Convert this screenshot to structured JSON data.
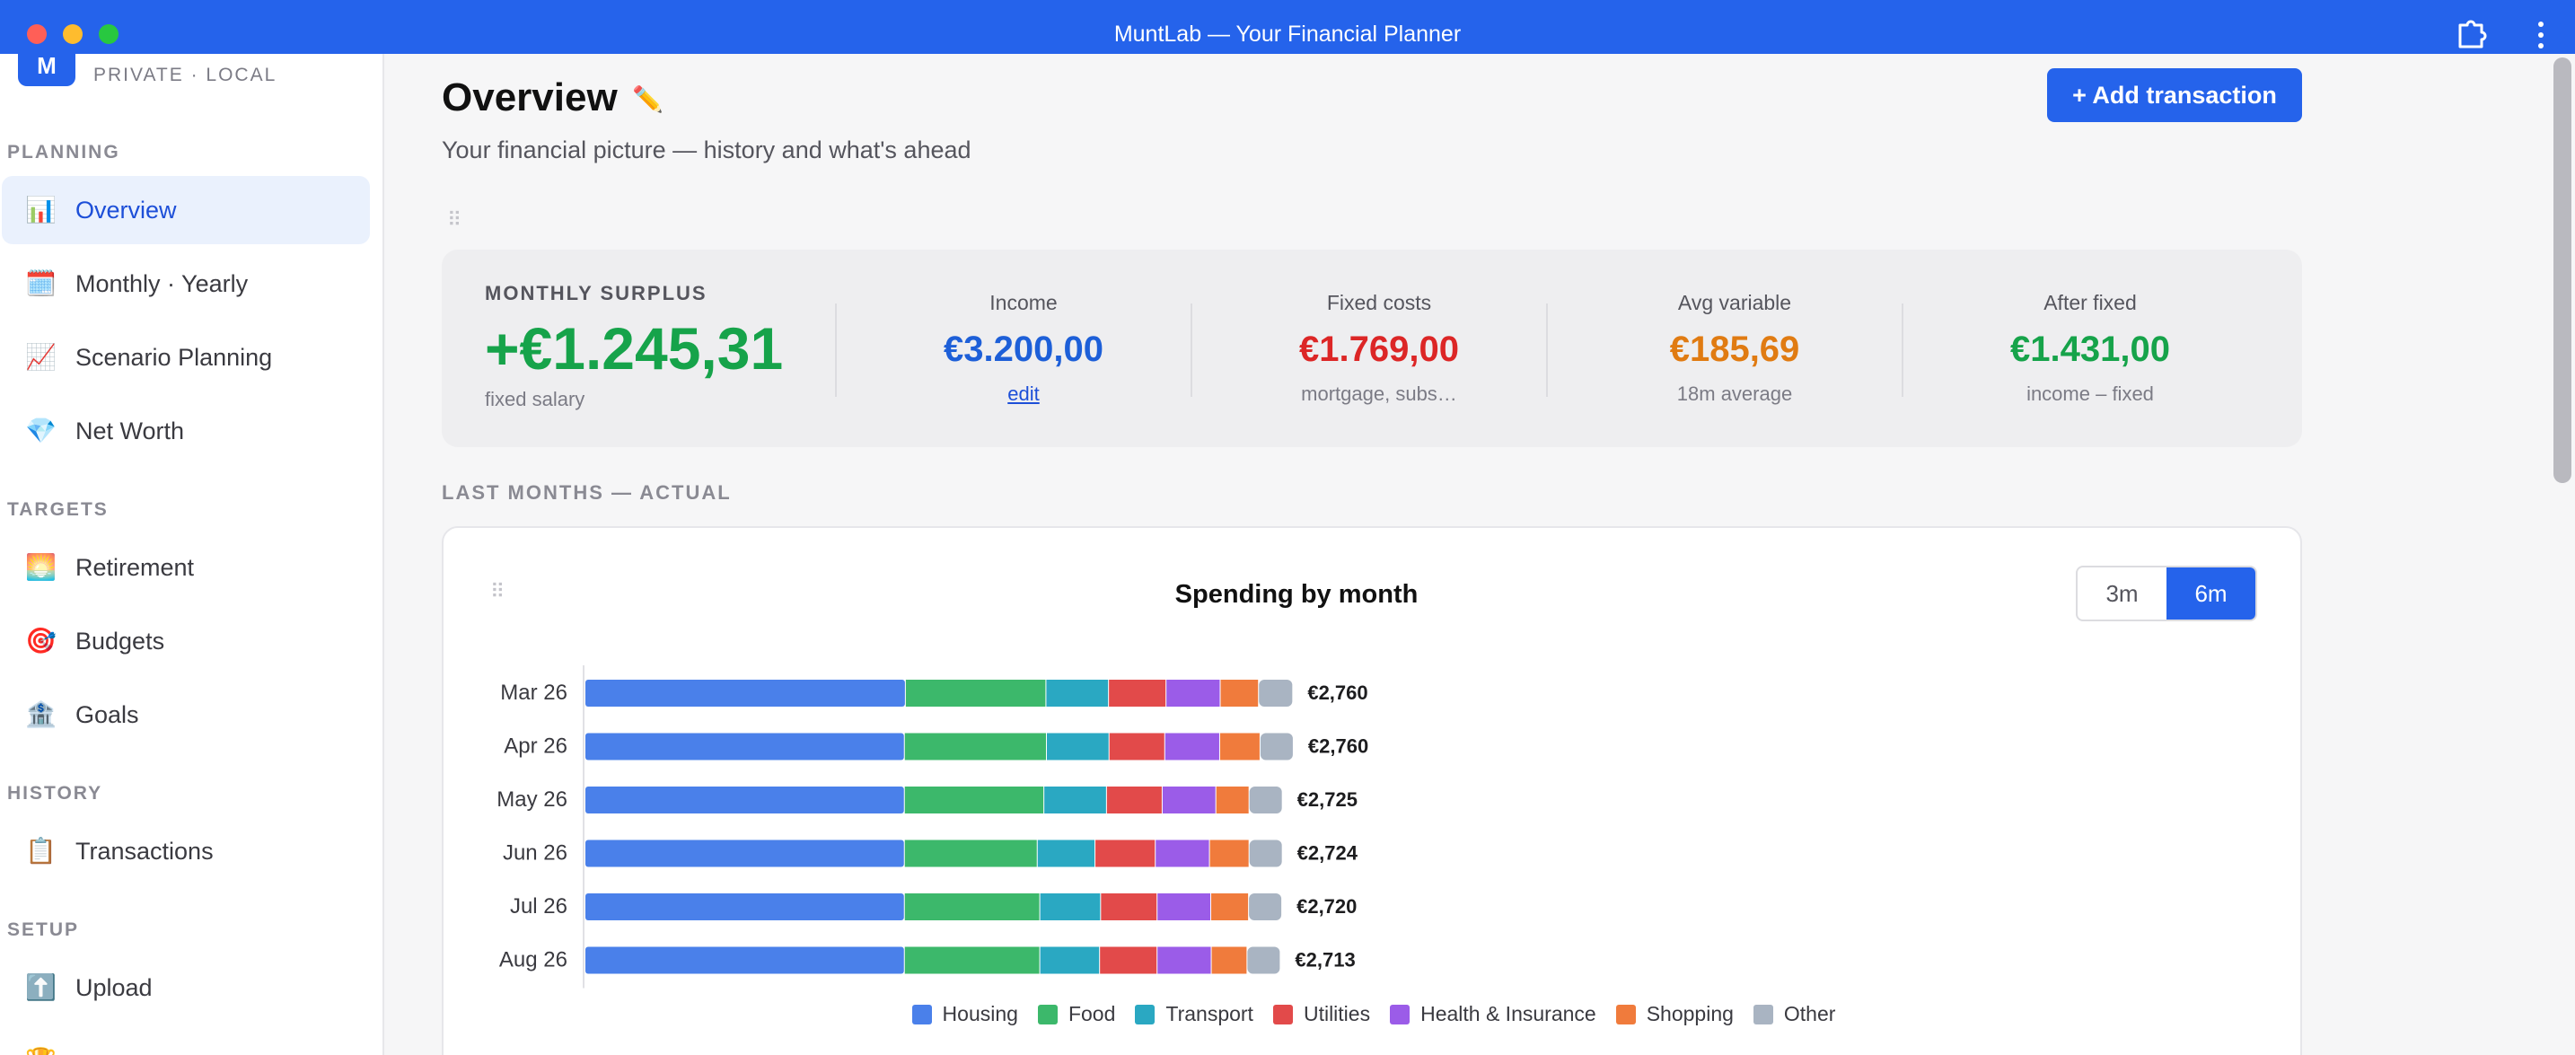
{
  "window": {
    "title": "MuntLab — Your Financial Planner"
  },
  "brand": {
    "logo_letter": "M",
    "subtitle": "PRIVATE · LOCAL"
  },
  "sidebar": {
    "sections": [
      {
        "label": "PLANNING",
        "items": [
          {
            "label": "Overview",
            "icon": "bar-chart-icon",
            "glyph": "📊",
            "active": true
          },
          {
            "label": "Monthly · Yearly",
            "icon": "calendar-icon",
            "glyph": "🗓️"
          },
          {
            "label": "Scenario Planning",
            "icon": "trend-chart-icon",
            "glyph": "📈"
          },
          {
            "label": "Net Worth",
            "icon": "gem-icon",
            "glyph": "💎"
          }
        ]
      },
      {
        "label": "TARGETS",
        "items": [
          {
            "label": "Retirement",
            "icon": "sunrise-icon",
            "glyph": "🌅"
          },
          {
            "label": "Budgets",
            "icon": "target-icon",
            "glyph": "🎯"
          },
          {
            "label": "Goals",
            "icon": "bank-icon",
            "glyph": "🏦"
          }
        ]
      },
      {
        "label": "HISTORY",
        "items": [
          {
            "label": "Transactions",
            "icon": "clipboard-icon",
            "glyph": "📋"
          }
        ]
      },
      {
        "label": "SETUP",
        "items": [
          {
            "label": "Upload",
            "icon": "upload-icon",
            "glyph": "⬆️"
          }
        ]
      }
    ]
  },
  "header": {
    "title": "Overview",
    "subtitle": "Your financial picture — history and what's ahead",
    "add_button": "+ Add transaction"
  },
  "summary": {
    "main": {
      "label": "MONTHLY SURPLUS",
      "value": "+€1.245,31",
      "note": "fixed salary"
    },
    "columns": [
      {
        "label": "Income",
        "value": "€3.200,00",
        "note": "edit",
        "color": "#1d5fd8",
        "link": true
      },
      {
        "label": "Fixed costs",
        "value": "€1.769,00",
        "note": "mortgage, subs…",
        "color": "#dc2626"
      },
      {
        "label": "Avg variable",
        "value": "€185,69",
        "note": "18m average",
        "color": "#e07b12"
      },
      {
        "label": "After fixed",
        "value": "€1.431,00",
        "note": "income – fixed",
        "color": "#16a34a"
      }
    ]
  },
  "section_title": "LAST MONTHS — ACTUAL",
  "chart_card": {
    "range_options": [
      "3m",
      "6m"
    ],
    "selected_range": "6m"
  },
  "chart_data": {
    "type": "bar",
    "orientation": "horizontal",
    "stacked": true,
    "title": "Spending by month",
    "categories": [
      "Mar 26",
      "Apr 26",
      "May 26",
      "Jun 26",
      "Jul 26",
      "Aug 26"
    ],
    "totals": [
      "€2,760",
      "€2,760",
      "€2,725",
      "€2,724",
      "€2,720",
      "€2,713"
    ],
    "series": [
      {
        "name": "Housing",
        "color": "#4a80ea",
        "values": [
          1254,
          1250,
          1250,
          1250,
          1250,
          1250
        ]
      },
      {
        "name": "Food",
        "color": "#3cb86b",
        "values": [
          550,
          556,
          546,
          520,
          530,
          530
        ]
      },
      {
        "name": "Transport",
        "color": "#2aa8c2",
        "values": [
          245,
          245,
          245,
          226,
          238,
          234
        ]
      },
      {
        "name": "Utilities",
        "color": "#e24a4a",
        "values": [
          225,
          218,
          218,
          236,
          221,
          225
        ]
      },
      {
        "name": "Health & Insurance",
        "color": "#9b5ce8",
        "values": [
          212,
          215,
          210,
          212,
          210,
          212
        ]
      },
      {
        "name": "Shopping",
        "color": "#f07b3c",
        "values": [
          150,
          158,
          130,
          155,
          148,
          140
        ]
      },
      {
        "name": "Other",
        "color": "#a9b4c2",
        "values": [
          134,
          130,
          130,
          130,
          130,
          130
        ]
      }
    ],
    "legend": "bottom",
    "grid": false
  }
}
